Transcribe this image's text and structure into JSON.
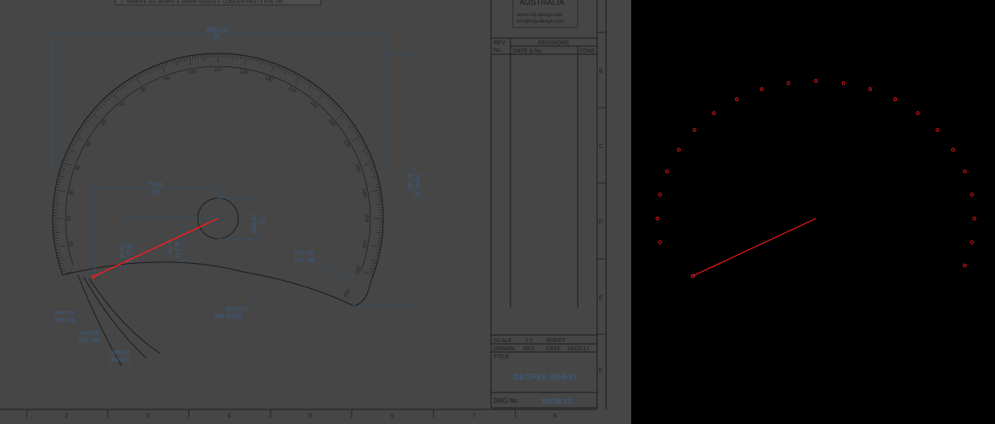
{
  "notes": {
    "line": "2. REMOVE ALL BURRS & SHARP EDGES    5. CONCENTRICITY 0.05 TIR"
  },
  "company": {
    "country": "AUSTRALIA",
    "web": "www.rsty-design.com",
    "email": "info@rsty-design.com"
  },
  "revisions": {
    "title": "REVISIONS",
    "rev_no_1": "REV",
    "rev_no_2": "No.",
    "date_col": "DATE & No.",
    "zone_col": "ZONE"
  },
  "title_block": {
    "scale_label": "SCALE",
    "scale_value": "1:1",
    "sheet_label": "SHEET",
    "drawn_label": "DRAWN",
    "drawn_value": "RFS",
    "date_label": "DATE",
    "date_value": "18/02/17",
    "title_label": "TITLE",
    "title_value": "DEGREE WHEEL",
    "drg_label": "DRG No",
    "drg_value": "RN3B 12"
  },
  "border": {
    "columns": [
      "2",
      "3",
      "4",
      "5",
      "6",
      "7",
      "8"
    ],
    "rows": [
      "B",
      "C",
      "D",
      "E",
      "F"
    ]
  },
  "dimensions": {
    "overall_width": "Ø203.20",
    "overall_width_in": "[8]",
    "overall_height": "185.26",
    "overall_height_in": "[7 19/64]",
    "center_offset_x": "75.03",
    "center_offset_x_in": "[3]",
    "hub_dia": "Ø25.40",
    "hub_dia_in": "[1]",
    "pointer_v1": "36.53",
    "pointer_v1_in": "[1 7/16]",
    "pointer_v2": "31.75",
    "pointer_v2_in": "[1 1/4]",
    "r_small": "R17.34",
    "r_small_in": "[R1 5/8]",
    "r_large": "R126.53",
    "r_large_in": "[R4 15/16]",
    "r1": "R95.25",
    "r1_in": "[R3 3/4]",
    "r2": "R92.08",
    "r2_in": "[R3 5/8]",
    "r3": "R88.90",
    "r3_in": "[R3 1/2]"
  },
  "dial": {
    "labels": [
      "10",
      "20",
      "30",
      "40",
      "50",
      "60",
      "70",
      "80",
      "90",
      "100",
      "110",
      "120",
      "130",
      "140",
      "150",
      "160",
      "170",
      "180",
      "190",
      "200",
      "210",
      "220",
      "230"
    ]
  },
  "colors": {
    "highlight": "#ff1a1a",
    "dimension": "#3a5f8a",
    "sheet": "#464646"
  }
}
